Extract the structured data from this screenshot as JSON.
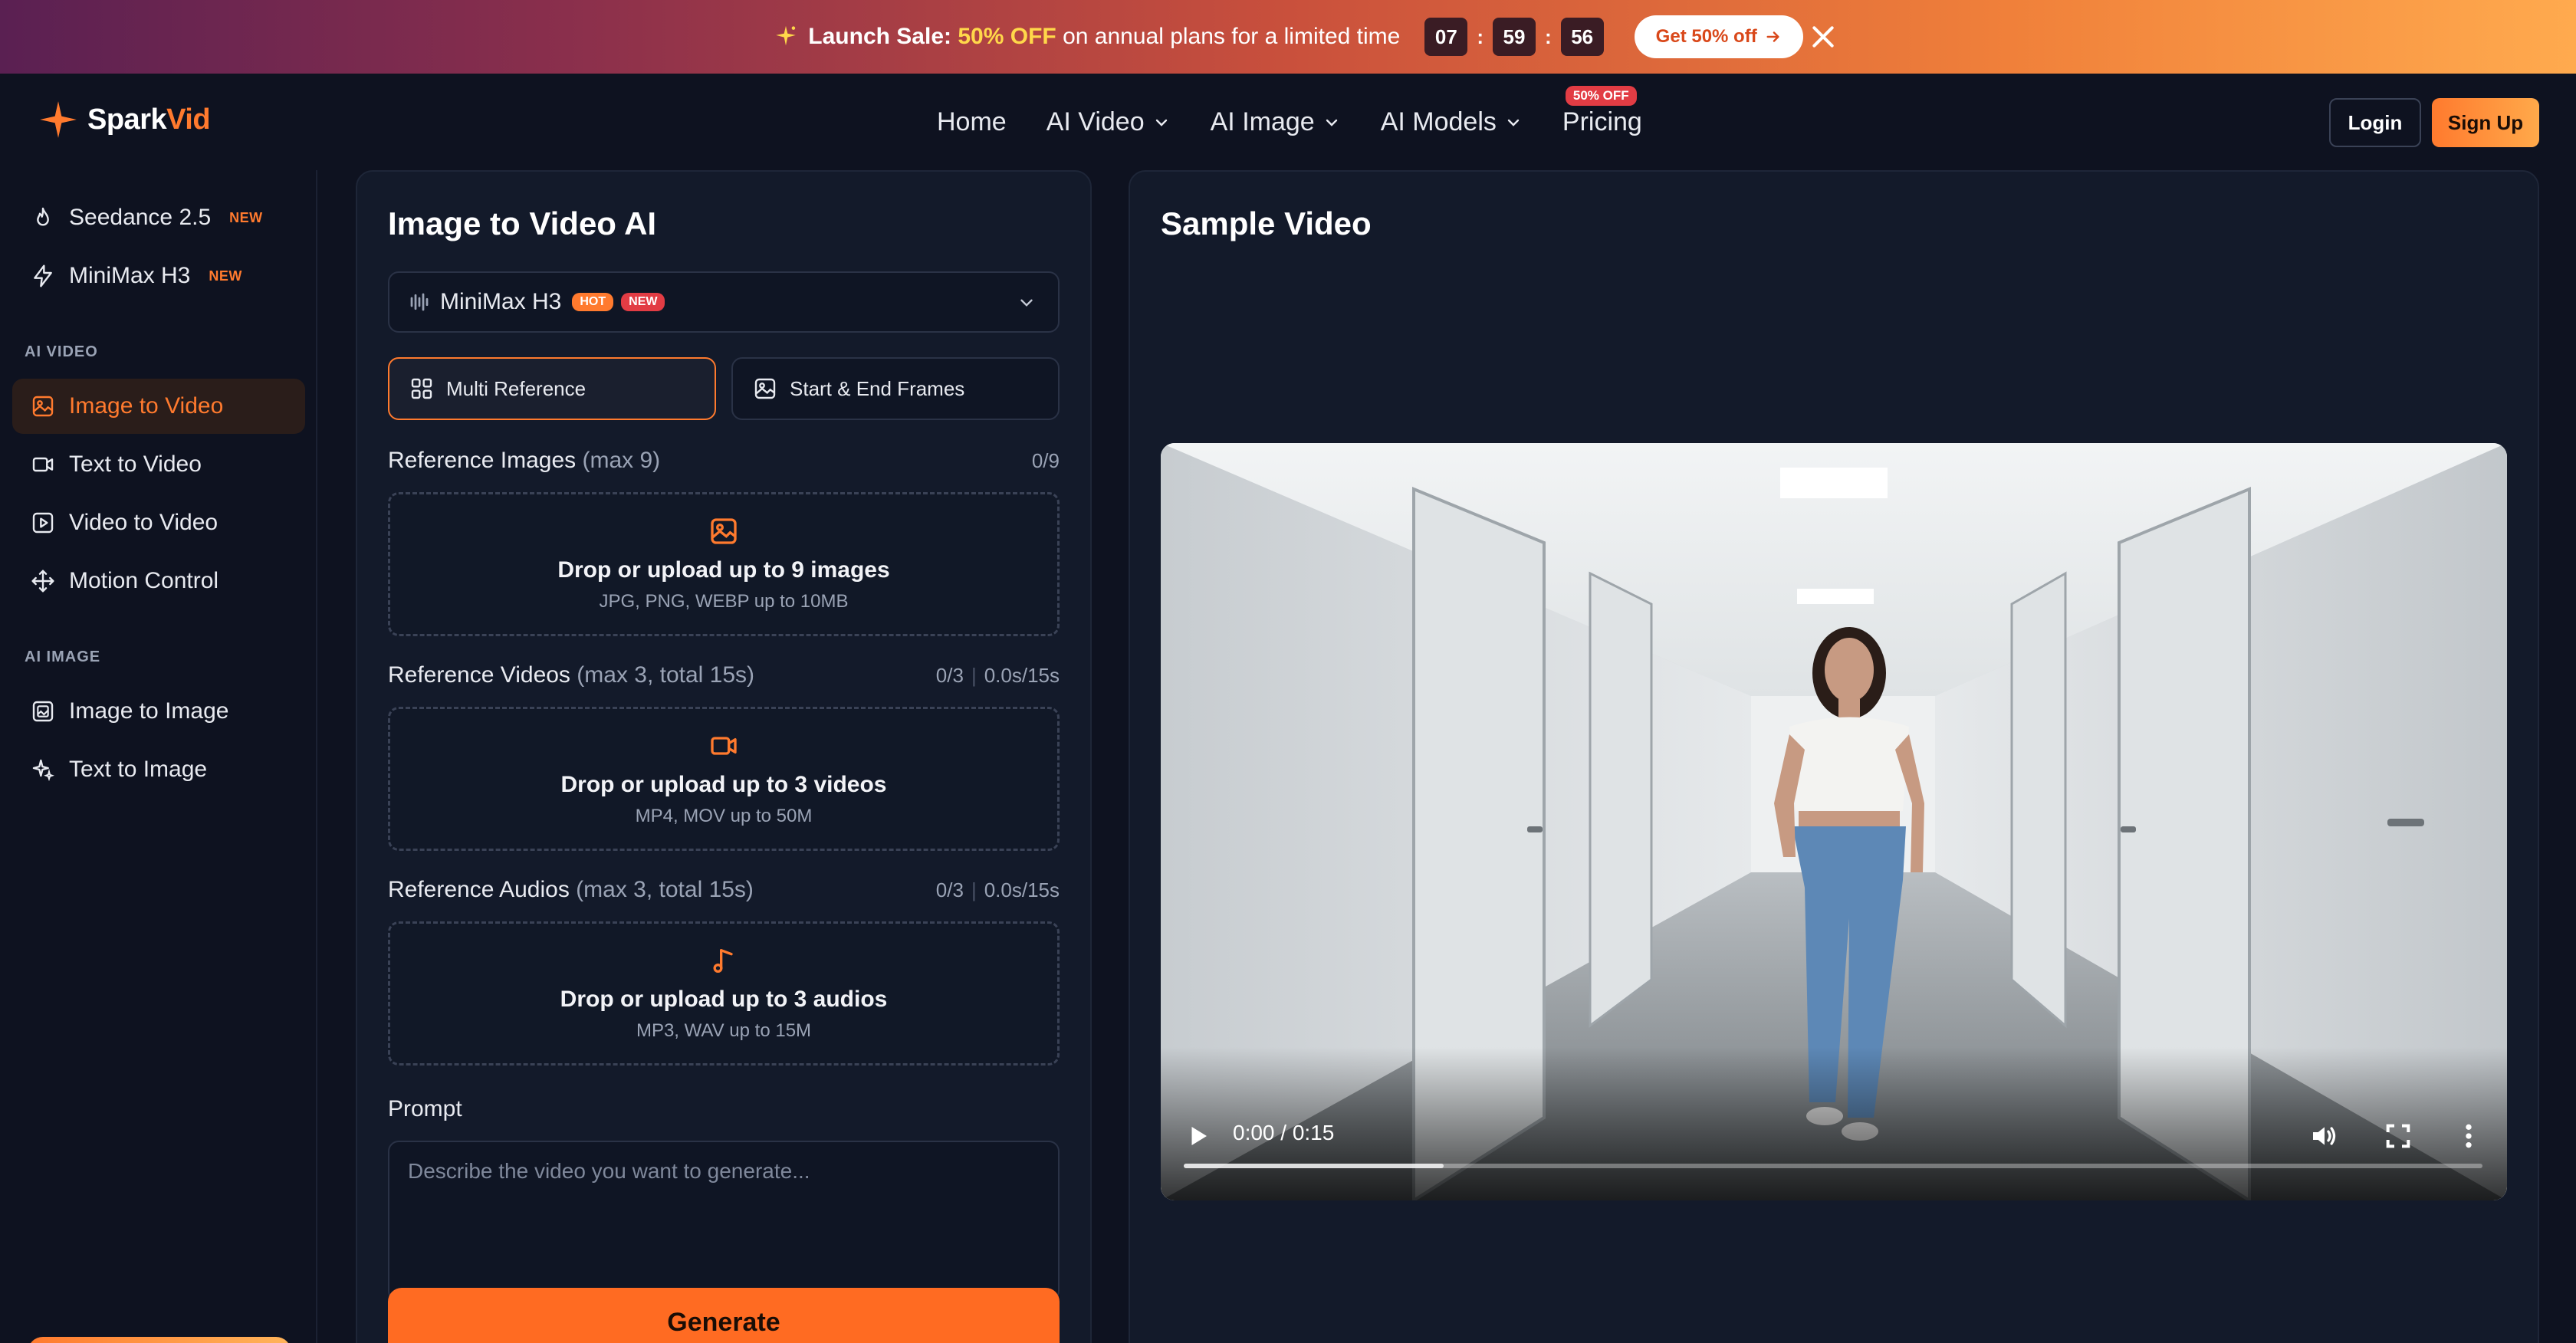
{
  "banner": {
    "prefix": "Launch Sale:",
    "highlight": "50% OFF",
    "suffix": "on annual plans for a limited time",
    "countdown": {
      "hours": "07",
      "minutes": "59",
      "seconds": "56",
      "sep": ":"
    },
    "cta": "Get 50% off"
  },
  "brand": {
    "name_a": "Spark",
    "name_b": "Vid"
  },
  "nav": {
    "items": [
      {
        "label": "Home",
        "dropdown": false
      },
      {
        "label": "AI Video",
        "dropdown": true
      },
      {
        "label": "AI Image",
        "dropdown": true
      },
      {
        "label": "AI Models",
        "dropdown": true
      },
      {
        "label": "Pricing",
        "dropdown": false,
        "badge": "50% OFF"
      }
    ],
    "login": "Login",
    "signup": "Sign Up"
  },
  "sidebar": {
    "featured": [
      {
        "label": "Seedance 2.5",
        "badge": "NEW",
        "icon": "flame-icon"
      },
      {
        "label": "MiniMax H3",
        "badge": "NEW",
        "icon": "bolt-icon"
      }
    ],
    "ai_video_heading": "AI VIDEO",
    "ai_video": [
      {
        "label": "Image to Video",
        "icon": "image-video-icon",
        "active": true
      },
      {
        "label": "Text to Video",
        "icon": "camera-icon"
      },
      {
        "label": "Video to Video",
        "icon": "play-square-icon"
      },
      {
        "label": "Motion Control",
        "icon": "move-icon"
      }
    ],
    "ai_image_heading": "AI IMAGE",
    "ai_image": [
      {
        "label": "Image to Image",
        "icon": "images-icon"
      },
      {
        "label": "Text to Image",
        "icon": "sparkles-icon"
      }
    ]
  },
  "form": {
    "title": "Image to Video AI",
    "model": {
      "name": "MiniMax H3",
      "badges": [
        "HOT",
        "NEW"
      ]
    },
    "modes": [
      {
        "label": "Multi Reference",
        "active": true
      },
      {
        "label": "Start & End Frames",
        "active": false
      }
    ],
    "images": {
      "label": "Reference Images",
      "limit": "(max 9)",
      "count": "0/9",
      "drop_title": "Drop or upload up to 9 images",
      "drop_sub": "JPG, PNG, WEBP up to 10MB"
    },
    "videos": {
      "label": "Reference Videos",
      "limit": "(max 3, total 15s)",
      "count": "0/3",
      "duration": "0.0s/15s",
      "drop_title": "Drop or upload up to 3 videos",
      "drop_sub": "MP4, MOV up to 50M"
    },
    "audios": {
      "label": "Reference Audios",
      "limit": "(max 3, total 15s)",
      "count": "0/3",
      "duration": "0.0s/15s",
      "drop_title": "Drop or upload up to 3 audios",
      "drop_sub": "MP3, WAV up to 15M"
    },
    "prompt_label": "Prompt",
    "prompt_placeholder": "Describe the video you want to generate...",
    "generate": "Generate"
  },
  "sample": {
    "title": "Sample Video",
    "time": "0:00 / 0:15",
    "buffered_fraction": 0.2
  },
  "colors": {
    "accent": "#ff7a2e",
    "bg": "#0e1220",
    "panel": "#131a2a"
  }
}
